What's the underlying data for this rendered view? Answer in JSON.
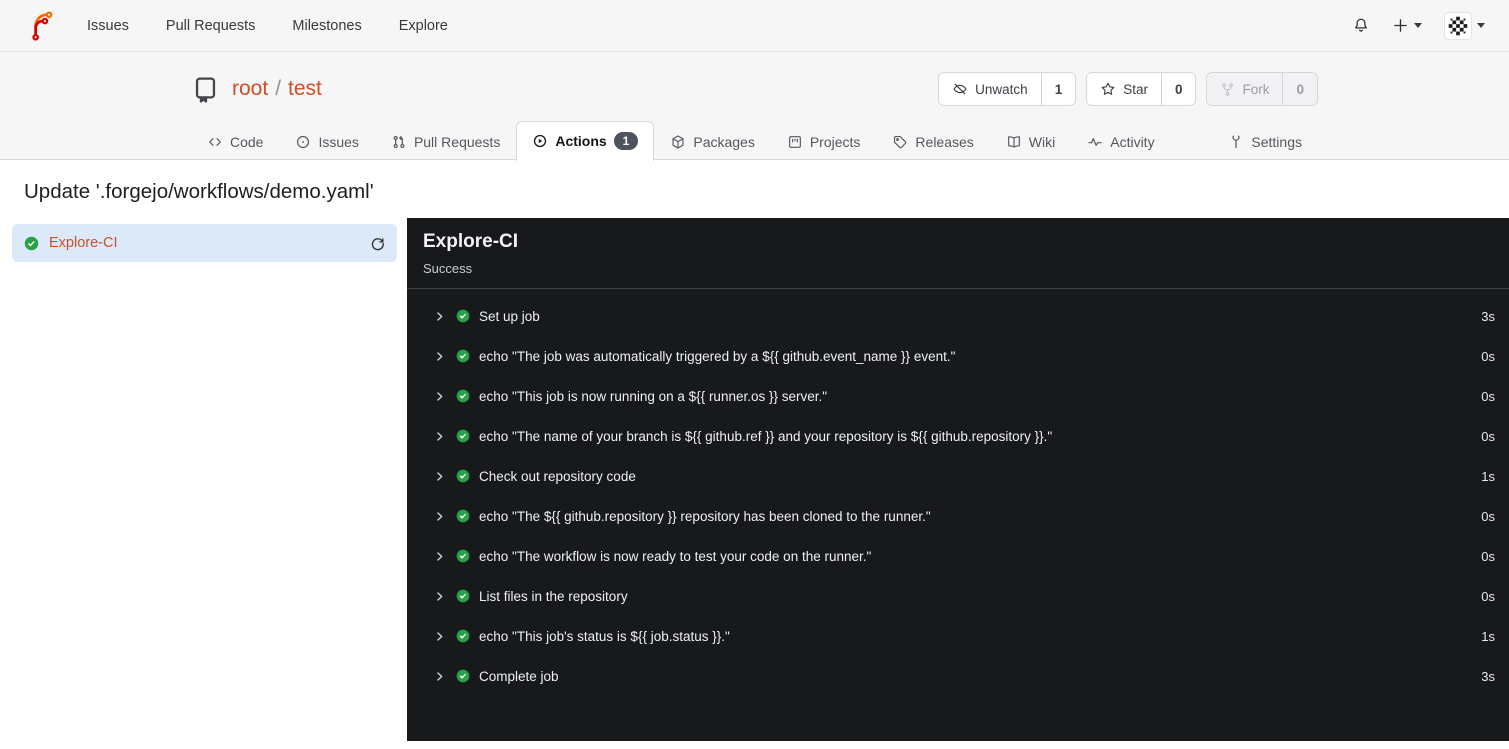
{
  "topnav": {
    "items": [
      {
        "label": "Issues"
      },
      {
        "label": "Pull Requests"
      },
      {
        "label": "Milestones"
      },
      {
        "label": "Explore"
      }
    ]
  },
  "repo": {
    "owner": "root",
    "separator": "/",
    "name": "test",
    "buttons": {
      "unwatch_label": "Unwatch",
      "unwatch_count": "1",
      "star_label": "Star",
      "star_count": "0",
      "fork_label": "Fork",
      "fork_count": "0"
    },
    "tabs": {
      "code": "Code",
      "issues": "Issues",
      "pulls": "Pull Requests",
      "actions": "Actions",
      "actions_badge": "1",
      "packages": "Packages",
      "projects": "Projects",
      "releases": "Releases",
      "wiki": "Wiki",
      "activity": "Activity",
      "settings": "Settings"
    }
  },
  "page": {
    "title": "Update '.forgejo/workflows/demo.yaml'"
  },
  "sidebar": {
    "job_label": "Explore-CI"
  },
  "panel": {
    "title": "Explore-CI",
    "status": "Success",
    "steps": [
      {
        "label": "Set up job",
        "duration": "3s"
      },
      {
        "label": "echo \"The job was automatically triggered by a ${{ github.event_name }} event.\"",
        "duration": "0s"
      },
      {
        "label": "echo \"This job is now running on a ${{ runner.os }} server.\"",
        "duration": "0s"
      },
      {
        "label": "echo \"The name of your branch is ${{ github.ref }} and your repository is ${{ github.repository }}.\"",
        "duration": "0s"
      },
      {
        "label": "Check out repository code",
        "duration": "1s"
      },
      {
        "label": "echo \"The ${{ github.repository }} repository has been cloned to the runner.\"",
        "duration": "0s"
      },
      {
        "label": "echo \"The workflow is now ready to test your code on the runner.\"",
        "duration": "0s"
      },
      {
        "label": "List files in the repository",
        "duration": "0s"
      },
      {
        "label": "echo \"This job's status is ${{ job.status }}.\"",
        "duration": "1s"
      },
      {
        "label": "Complete job",
        "duration": "3s"
      }
    ]
  },
  "colors": {
    "accent_orange": "#cd4e28",
    "success_green": "#26a148",
    "panel_bg": "#18191b",
    "selected_job_bg": "#dbe9f8",
    "badge_bg": "#4e545e",
    "header_bg": "#f6f6f7"
  }
}
